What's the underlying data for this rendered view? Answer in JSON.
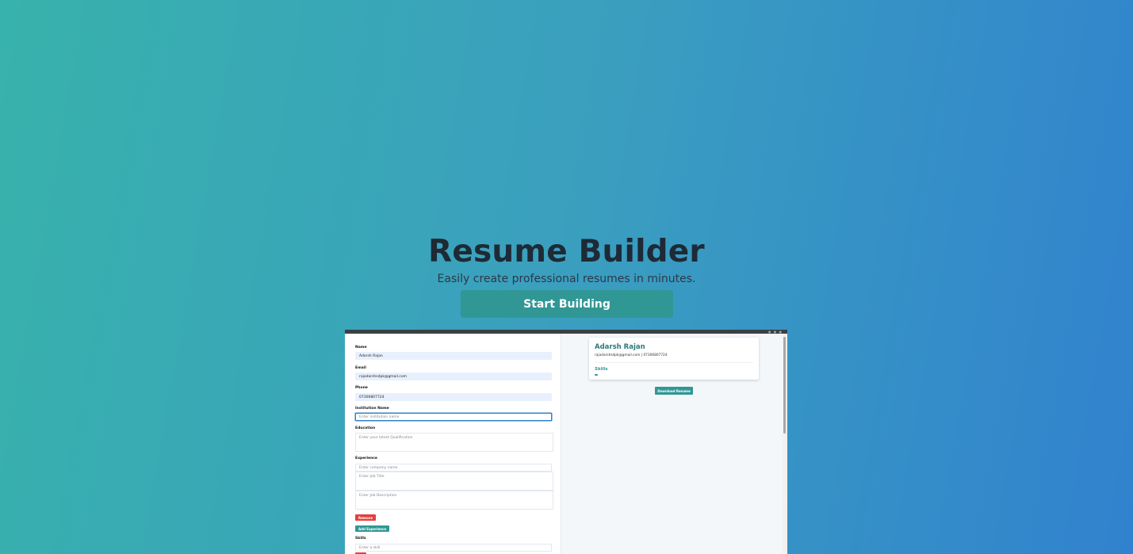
{
  "hero": {
    "title": "Resume Builder",
    "subtitle": "Easily create professional resumes in minutes.",
    "cta_label": "Start Building"
  },
  "form": {
    "name_label": "Name",
    "name_value": "Adarsh Rajan",
    "email_label": "Email",
    "email_value": "rajadarshsdpk@gmail.com",
    "phone_label": "Phone",
    "phone_value": "07306807724",
    "institution_label": "Institution Name",
    "institution_placeholder": "Enter institution name",
    "education_label": "Education",
    "education_placeholder": "Enter your latest Qualification",
    "experience_label": "Experience",
    "company_placeholder": "Enter company name",
    "job_title_placeholder": "Enter Job Title",
    "job_desc_placeholder": "Enter Job Description",
    "remove_label": "Remove",
    "add_experience_label": "Add Experience",
    "skills_label": "Skills",
    "skill_placeholder": "Enter a skill"
  },
  "preview": {
    "name": "Adarsh Rajan",
    "contact": "rajadarshsdpk@gmail.com | 07306807724",
    "skills_heading": "Skills",
    "download_label": "Download Resume"
  },
  "colors": {
    "accent": "#319795",
    "danger": "#e53e3e",
    "gradient_start": "#38b2ac",
    "gradient_end": "#3182ce"
  }
}
